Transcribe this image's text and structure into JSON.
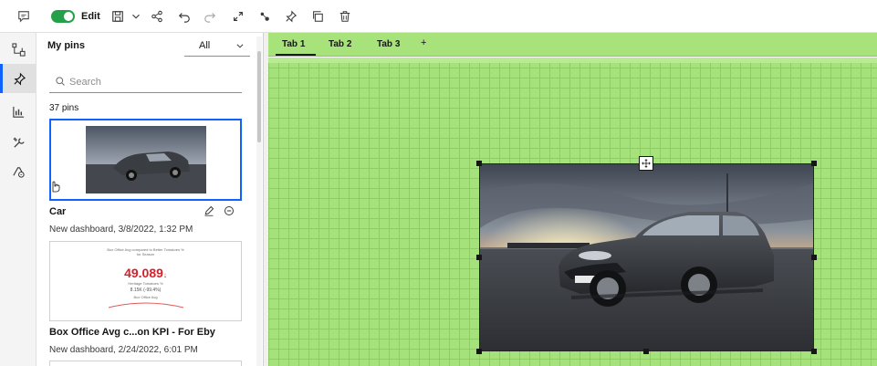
{
  "toolbar": {
    "edit_label": "Edit",
    "edit_mode_on": true,
    "accent_color": "#24a148",
    "icons": [
      "comment-icon",
      "save-icon",
      "chevron-down-icon",
      "share-icon",
      "undo-icon",
      "redo-icon",
      "expand-icon",
      "connect-icon",
      "pin-icon",
      "copy-icon",
      "delete-icon"
    ]
  },
  "rail": {
    "items": [
      "data-sources-icon",
      "pin-icon",
      "visualizations-icon",
      "tools-icon",
      "assistant-icon"
    ],
    "active_index": 1
  },
  "pins_panel": {
    "title": "My pins",
    "filter": {
      "selected": "All"
    },
    "search": {
      "placeholder": "Search",
      "value": ""
    },
    "count_label": "37 pins",
    "pins": [
      {
        "name": "Car",
        "meta": "New dashboard, 3/8/2022, 1:32 PM",
        "selected": true
      },
      {
        "name": "Box Office Avg c...on KPI - For Eby",
        "meta": "New dashboard, 2/24/2022, 6:01 PM",
        "preview": {
          "caption": "Box Office Avg compared to Better Tomatoes % for Season",
          "value": "49.089",
          "value_unit": "↓",
          "subcaption": "Heritage Tomatoes %",
          "change": "8.15K (-99.4%)",
          "footer": "Box Office Avg",
          "value_color": "#da1e28"
        }
      }
    ]
  },
  "canvas": {
    "tabs": [
      {
        "label": "Tab 1",
        "active": true
      },
      {
        "label": "Tab 2",
        "active": false
      },
      {
        "label": "Tab 3",
        "active": false
      }
    ],
    "add_tab_label": "+",
    "background_color": "#a6e27c"
  }
}
